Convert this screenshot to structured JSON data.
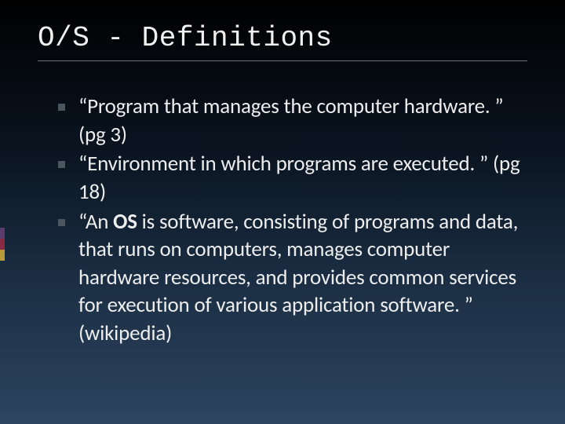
{
  "slide": {
    "title": "O/S - Definitions",
    "bullets": [
      {
        "text": "“Program that manages the computer hardware. ” (pg 3)"
      },
      {
        "text": "“Environment in which programs are executed. ” (pg 18)"
      },
      {
        "prefix": "“An ",
        "bold": "OS",
        "suffix": " is software, consisting of programs and data, that runs on computers, manages computer hardware resources, and provides common services for execution of various application software. ” (wikipedia)"
      }
    ]
  },
  "accent_colors": [
    "#5a3d6b",
    "#8a2a42",
    "#b89a3a"
  ]
}
